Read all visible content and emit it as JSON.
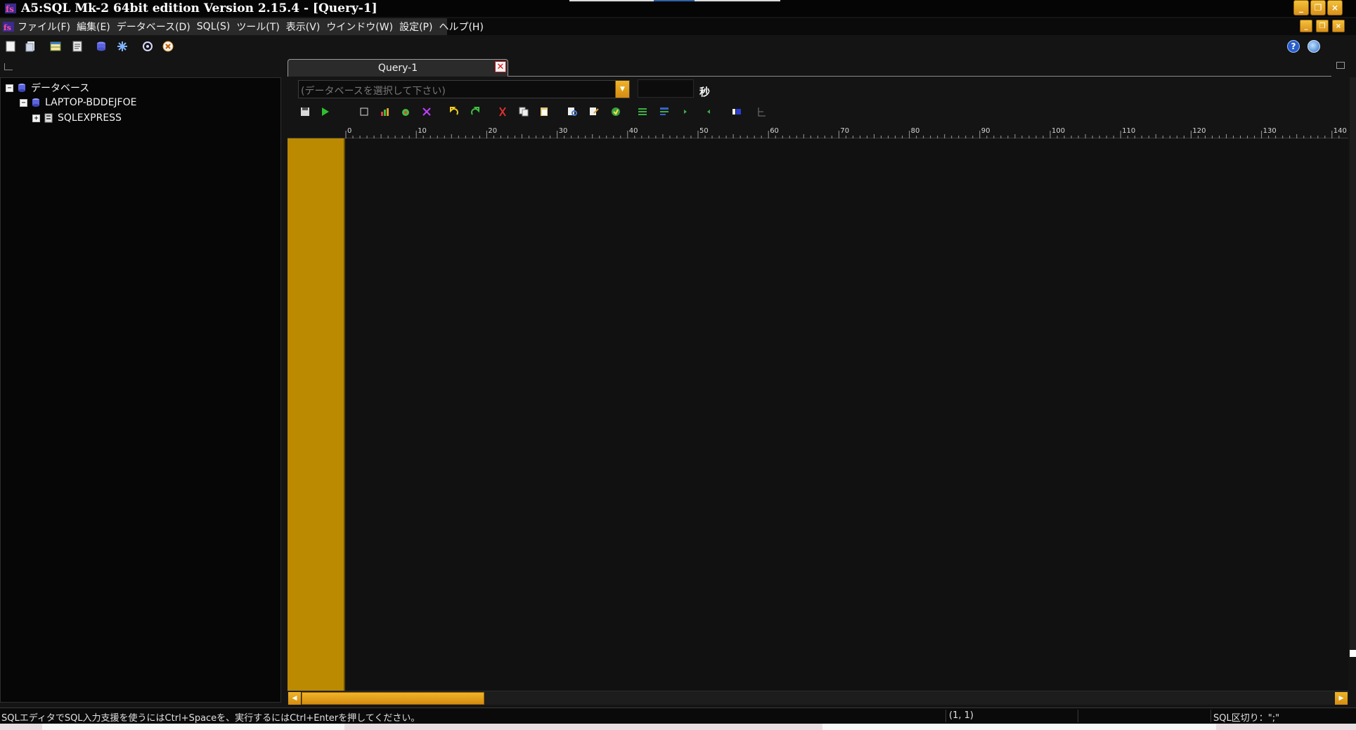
{
  "window": {
    "title": "A5:SQL Mk-2 64bit edition Version 2.15.4 - [Query-1]",
    "accent_color": "#e9a11e",
    "controls": [
      "_",
      "❐",
      "×"
    ]
  },
  "menubar": {
    "items": [
      "ファイル(F)",
      "編集(E)",
      "データベース(D)",
      "SQL(S)",
      "ツール(T)",
      "表示(V)",
      "ウインドウ(W)",
      "設定(P)",
      "ヘルプ(H)"
    ],
    "mdi_controls": [
      "_",
      "❐",
      "×"
    ]
  },
  "toolbar": {
    "icons": [
      "new-document-icon",
      "open-file-icon",
      "table-icon",
      "script-icon",
      "database-icon",
      "snowflake-icon",
      "at-icon",
      "close-circle-icon"
    ],
    "help_label": "?",
    "web_icon": "globe-icon"
  },
  "tree": {
    "root_label": "データベース",
    "server_label": "LAPTOP-BDDEJFOE",
    "instance_label": "SQLEXPRESS",
    "collapse_glyph": "−",
    "expand_glyph": "+"
  },
  "tab": {
    "label": "Query-1",
    "close_glyph": "✕"
  },
  "query": {
    "db_placeholder": "(データベースを選択して下さい)",
    "timeout_value": "",
    "seconds_label": "秒",
    "dropdown_glyph": "▼"
  },
  "ruler": {
    "labels": [
      "0",
      "10",
      "20",
      "30",
      "40",
      "50",
      "60",
      "70",
      "80",
      "90",
      "100",
      "110",
      "120",
      "130",
      "140"
    ]
  },
  "scrollbar": {
    "left_arrow": "◀",
    "right_arrow": "▶"
  },
  "statusbar": {
    "message": "SQLエディタでSQL入力支援を使うにはCtrl+Spaceを、実行するにはCtrl+Enterを押してください。",
    "cursor_position": "(1, 1)",
    "sql_delimiter": "SQL区切り：\";\""
  }
}
